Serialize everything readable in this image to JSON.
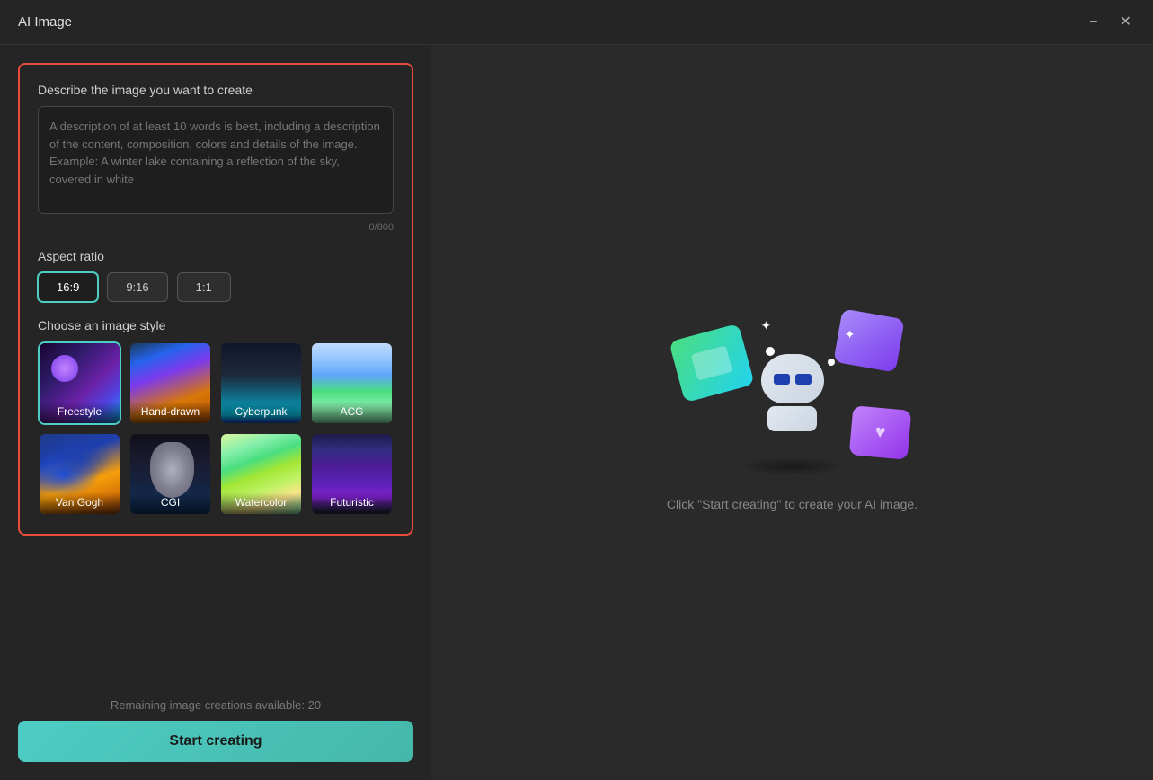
{
  "titleBar": {
    "title": "AI Image",
    "minimizeLabel": "−",
    "closeLabel": "✕"
  },
  "leftPanel": {
    "sectionDescribeLabel": "Describe the image you want to create",
    "textarea": {
      "placeholder": "A description of at least 10 words is best, including a description of the content, composition, colors and details of the image. Example: A winter lake containing a reflection of the sky, covered in white",
      "value": "",
      "charCount": "0/800"
    },
    "aspectRatioLabel": "Aspect ratio",
    "aspectRatioOptions": [
      {
        "label": "16:9",
        "active": true
      },
      {
        "label": "9:16",
        "active": false
      },
      {
        "label": "1:1",
        "active": false
      }
    ],
    "imageStyleLabel": "Choose an image style",
    "styleOptions": [
      {
        "label": "Freestyle",
        "active": true,
        "key": "freestyle"
      },
      {
        "label": "Hand-drawn",
        "active": false,
        "key": "handdrawn"
      },
      {
        "label": "Cyberpunk",
        "active": false,
        "key": "cyberpunk"
      },
      {
        "label": "ACG",
        "active": false,
        "key": "acg"
      },
      {
        "label": "Van Gogh",
        "active": false,
        "key": "vangogh"
      },
      {
        "label": "CGI",
        "active": false,
        "key": "cgi"
      },
      {
        "label": "Watercolor",
        "active": false,
        "key": "watercolor"
      },
      {
        "label": "Futuristic",
        "active": false,
        "key": "futuristic"
      }
    ],
    "remainingText": "Remaining image creations available: 20",
    "startButtonLabel": "Start creating"
  },
  "rightPanel": {
    "hintText": "Click \"Start creating\" to create your AI image."
  }
}
